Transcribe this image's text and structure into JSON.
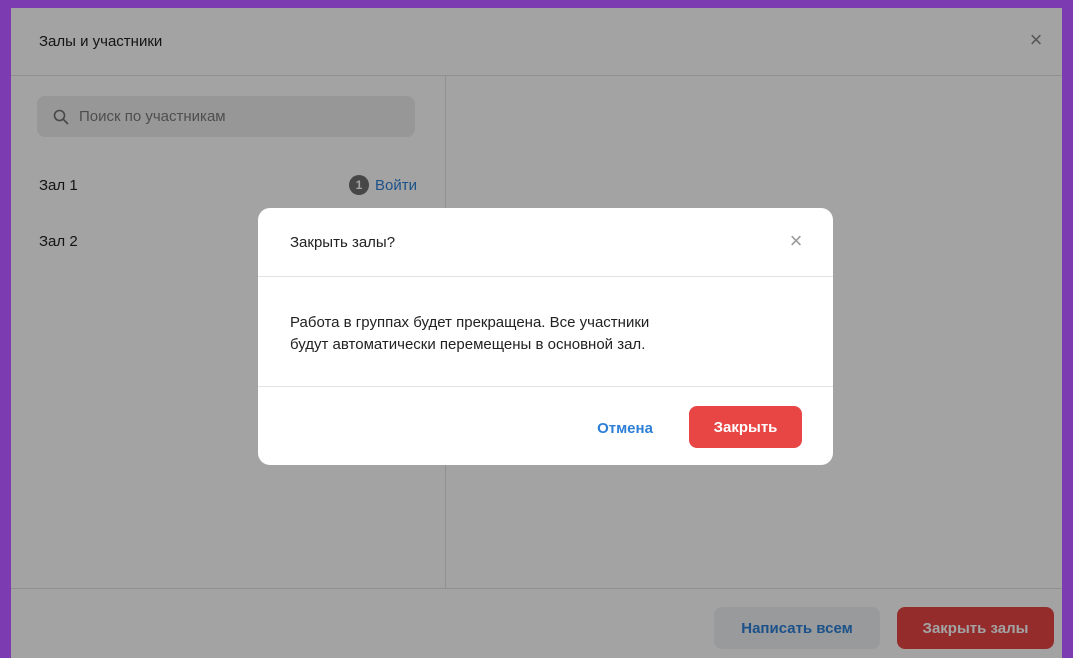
{
  "window": {
    "title": "Залы и участники",
    "close_glyph": "×"
  },
  "search": {
    "placeholder": "Поиск по участникам",
    "icon": "search-icon"
  },
  "rooms": [
    {
      "name": "Зал 1",
      "count": "1",
      "action": "Войти"
    },
    {
      "name": "Зал 2"
    }
  ],
  "footer": {
    "write_all_label": "Написать всем",
    "close_rooms_label": "Закрыть залы"
  },
  "modal": {
    "title": "Закрыть залы?",
    "close_glyph": "×",
    "body_line1": "Работа в группах будет прекращена. Все участники",
    "body_line2": "будут автоматически перемещены в основной зал.",
    "cancel_label": "Отмена",
    "confirm_label": "Закрыть"
  },
  "colors": {
    "accent_blue": "#2d7fd6",
    "danger_red": "#e84545",
    "frame_purple": "#7c3bb0"
  }
}
